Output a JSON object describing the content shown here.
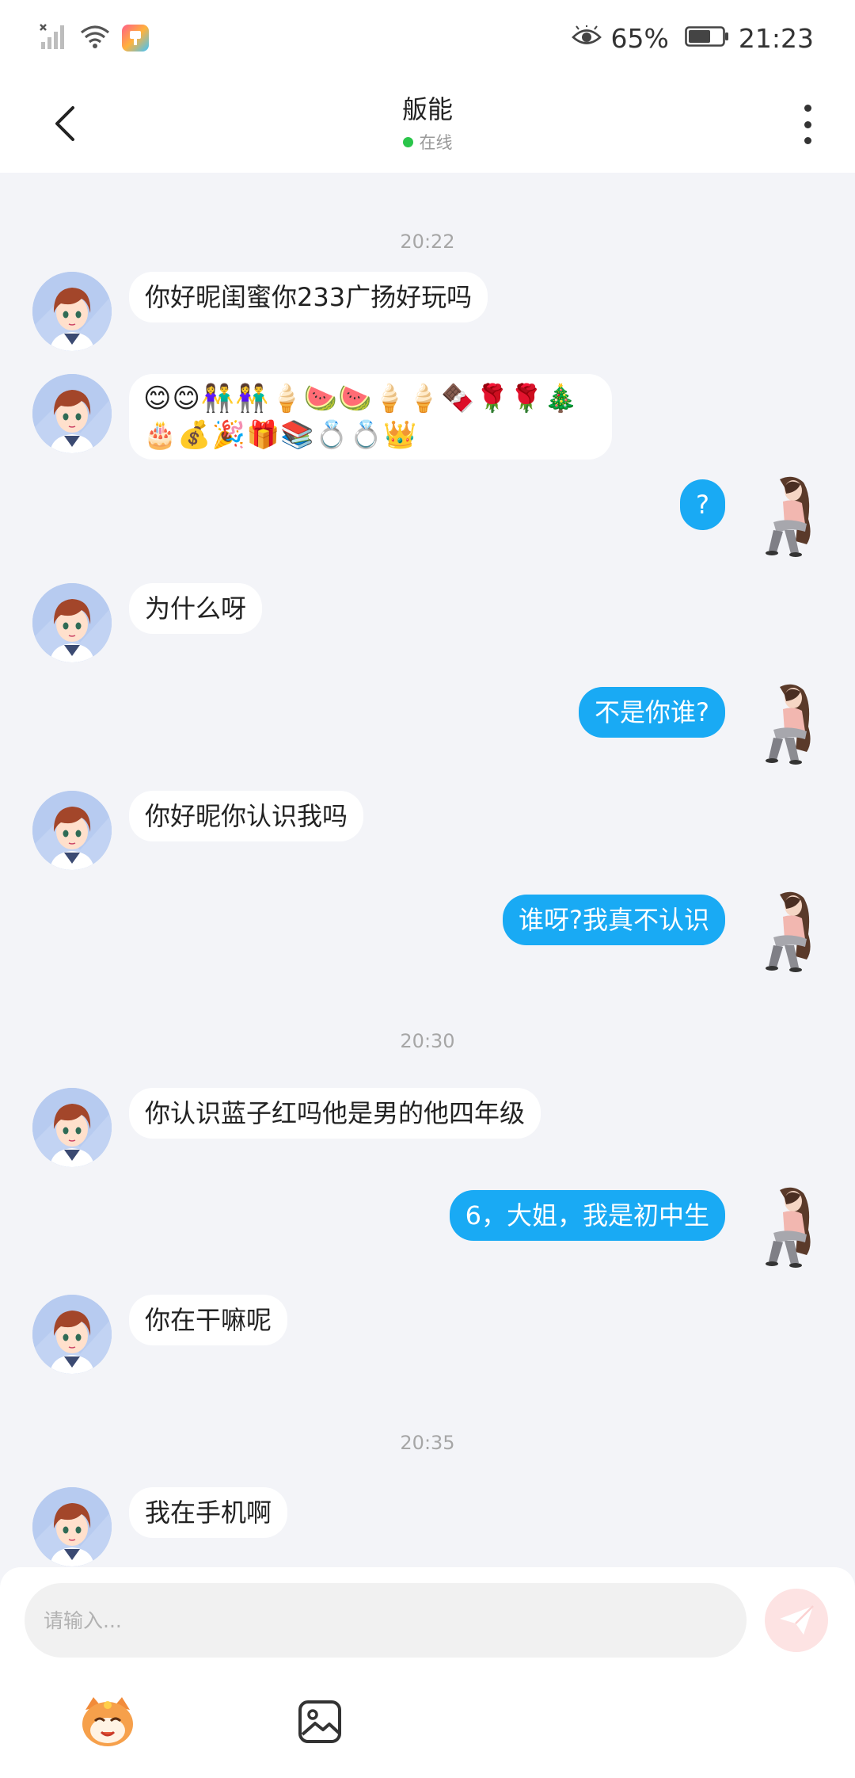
{
  "status_bar": {
    "battery_percent": "65%",
    "time": "21:23",
    "signal_icon": "signal-off-icon",
    "wifi_icon": "wifi-icon",
    "eye_icon": "eye-comfort-icon",
    "battery_icon": "battery-icon",
    "battery_level": 0.65
  },
  "header": {
    "title": "舨能",
    "presence": "在线",
    "presence_color": "#2ac54a"
  },
  "messages": [
    {
      "type": "time",
      "text": "20:22"
    },
    {
      "type": "in",
      "text": "你好昵闺蜜你233广扬好玩吗"
    },
    {
      "type": "in",
      "text": "😊😊👫👫🍦🍉🍉🍦🍦🍫🌹🌹🎄🎂💰🎉🎁📚💍💍👑"
    },
    {
      "type": "out",
      "text": "?"
    },
    {
      "type": "in",
      "text": "为什么呀"
    },
    {
      "type": "out",
      "text": "不是你谁?"
    },
    {
      "type": "in",
      "text": "你好昵你认识我吗"
    },
    {
      "type": "out",
      "text": "谁呀?我真不认识"
    },
    {
      "type": "time",
      "text": "20:30"
    },
    {
      "type": "in",
      "text": "你认识蓝子红吗他是男的他四年级"
    },
    {
      "type": "out",
      "text": "6，大姐，我是初中生"
    },
    {
      "type": "in",
      "text": "你在干嘛呢"
    },
    {
      "type": "time",
      "text": "20:35"
    },
    {
      "type": "in",
      "text": "我在手机啊"
    }
  ],
  "composer": {
    "placeholder": "请输入...",
    "send_icon": "send-icon",
    "emoji_icon": "emoji-mascot-icon",
    "image_icon": "image-icon"
  },
  "colors": {
    "outgoing_bubble": "#19aaf4",
    "incoming_bubble": "#ffffff",
    "background": "#f3f4f8",
    "send_button": "#fde3e3"
  }
}
